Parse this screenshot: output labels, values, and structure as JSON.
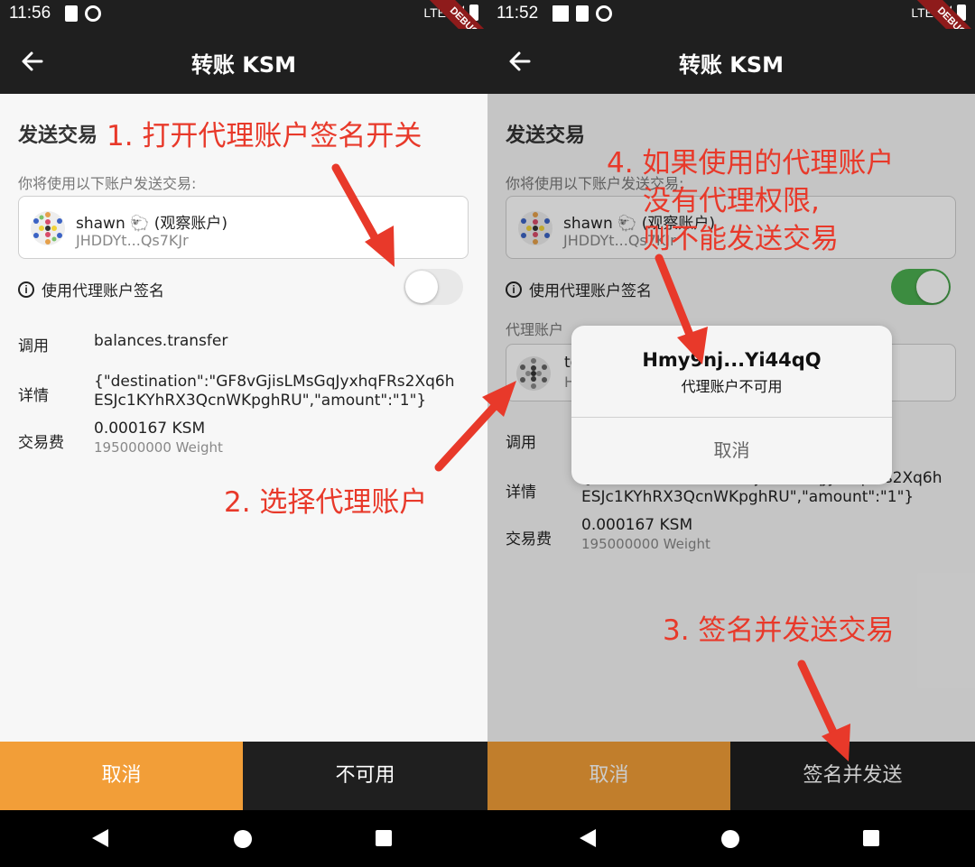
{
  "status_left": {
    "time": "11:56",
    "network": "LTE",
    "debug": "DEBUG"
  },
  "status_right": {
    "time": "11:52",
    "network": "LTE",
    "debug": "DEBUG"
  },
  "app_bar": {
    "title": "转账 KSM"
  },
  "form": {
    "section_title": "发送交易",
    "hint": "你将使用以下账户发送交易:",
    "account": {
      "name": "shawn 🐑 (观察账户)",
      "address": "JHDDYt...Qs7KJr"
    },
    "proxy_toggle_label": "使用代理账户签名",
    "proxy_label": "代理账户",
    "proxy_account": {
      "name": "te",
      "address": "H"
    },
    "call_label": "调用",
    "call_value": "balances.transfer",
    "details_label": "详情",
    "details_line1": "{\"destination\":\"GF8vGjisLMsGqJyxhqFRs2Xq6h",
    "details_line2": "ESJc1KYhRX3QcnWKpghRU\",\"amount\":\"1\"}",
    "fee_label": "交易费",
    "fee_value": "0.000167 KSM",
    "fee_weight": "195000000 Weight"
  },
  "bottom_left": {
    "cancel": "取消",
    "action": "不可用"
  },
  "bottom_right": {
    "cancel": "取消",
    "action": "签名并发送"
  },
  "dialog": {
    "title": "Hmy9nj...Yi44qQ",
    "message": "代理账户不可用",
    "cancel": "取消"
  },
  "annotations": {
    "step1": "1. 打开代理账户签名开关",
    "step2": "2. 选择代理账户",
    "step3": "3. 签名并发送交易",
    "step4_line1": "4. 如果使用的代理账户",
    "step4_line2": "没有代理权限,",
    "step4_line3": "则不能发送交易"
  },
  "colors": {
    "app_bar": "#1f1f1f",
    "cancel_button": "#f29e38",
    "toggle_on": "#4caf50",
    "annotation": "#e8392a",
    "debug_ribbon": "#8e1b1b"
  },
  "icons": [
    "back-arrow-icon",
    "info-icon",
    "identicon",
    "sd-card-icon",
    "sync-icon",
    "signal-icon",
    "battery-icon",
    "nav-back-icon",
    "nav-home-icon",
    "nav-recent-icon"
  ]
}
